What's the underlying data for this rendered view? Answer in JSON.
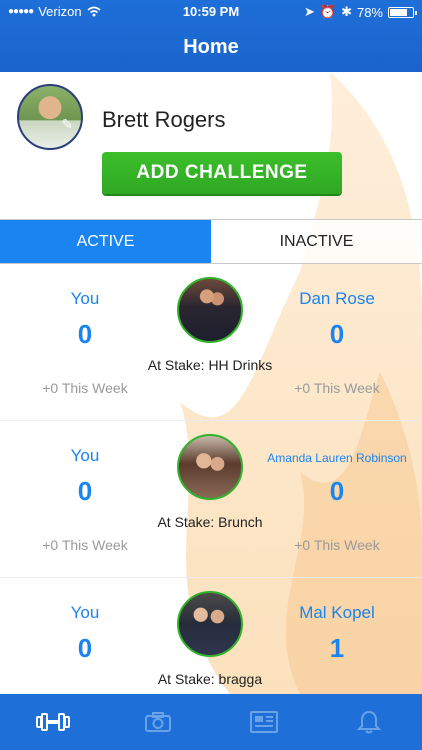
{
  "status_bar": {
    "carrier": "Verizon",
    "time": "10:59 PM",
    "battery": "78%"
  },
  "nav": {
    "title": "Home"
  },
  "profile": {
    "name": "Brett Rogers",
    "add_challenge_label": "ADD CHALLENGE"
  },
  "tabs": [
    {
      "label": "ACTIVE",
      "selected": true
    },
    {
      "label": "INACTIVE",
      "selected": false
    }
  ],
  "challenges": [
    {
      "left_player": "You",
      "left_score": "0",
      "left_week": "+0 This Week",
      "right_player": "Dan Rose",
      "right_score": "0",
      "right_week": "+0 This Week",
      "stake": "At Stake: HH Drinks"
    },
    {
      "left_player": "You",
      "left_score": "0",
      "left_week": "+0 This Week",
      "right_player": "Amanda Lauren Robinson",
      "right_score": "0",
      "right_week": "+0 This Week",
      "stake": "At Stake: Brunch"
    },
    {
      "left_player": "You",
      "left_score": "0",
      "left_week": "",
      "right_player": "Mal Kopel",
      "right_score": "1",
      "right_week": "",
      "stake": "At Stake: bragga"
    }
  ],
  "tab_bar": {
    "items": [
      "dumbbell-icon",
      "camera-icon",
      "newspaper-icon",
      "bell-icon"
    ]
  },
  "colors": {
    "primary_blue": "#1f6fd8",
    "accent_blue": "#1a84f0",
    "green": "#30b22a",
    "muted": "#9a9a9a"
  }
}
